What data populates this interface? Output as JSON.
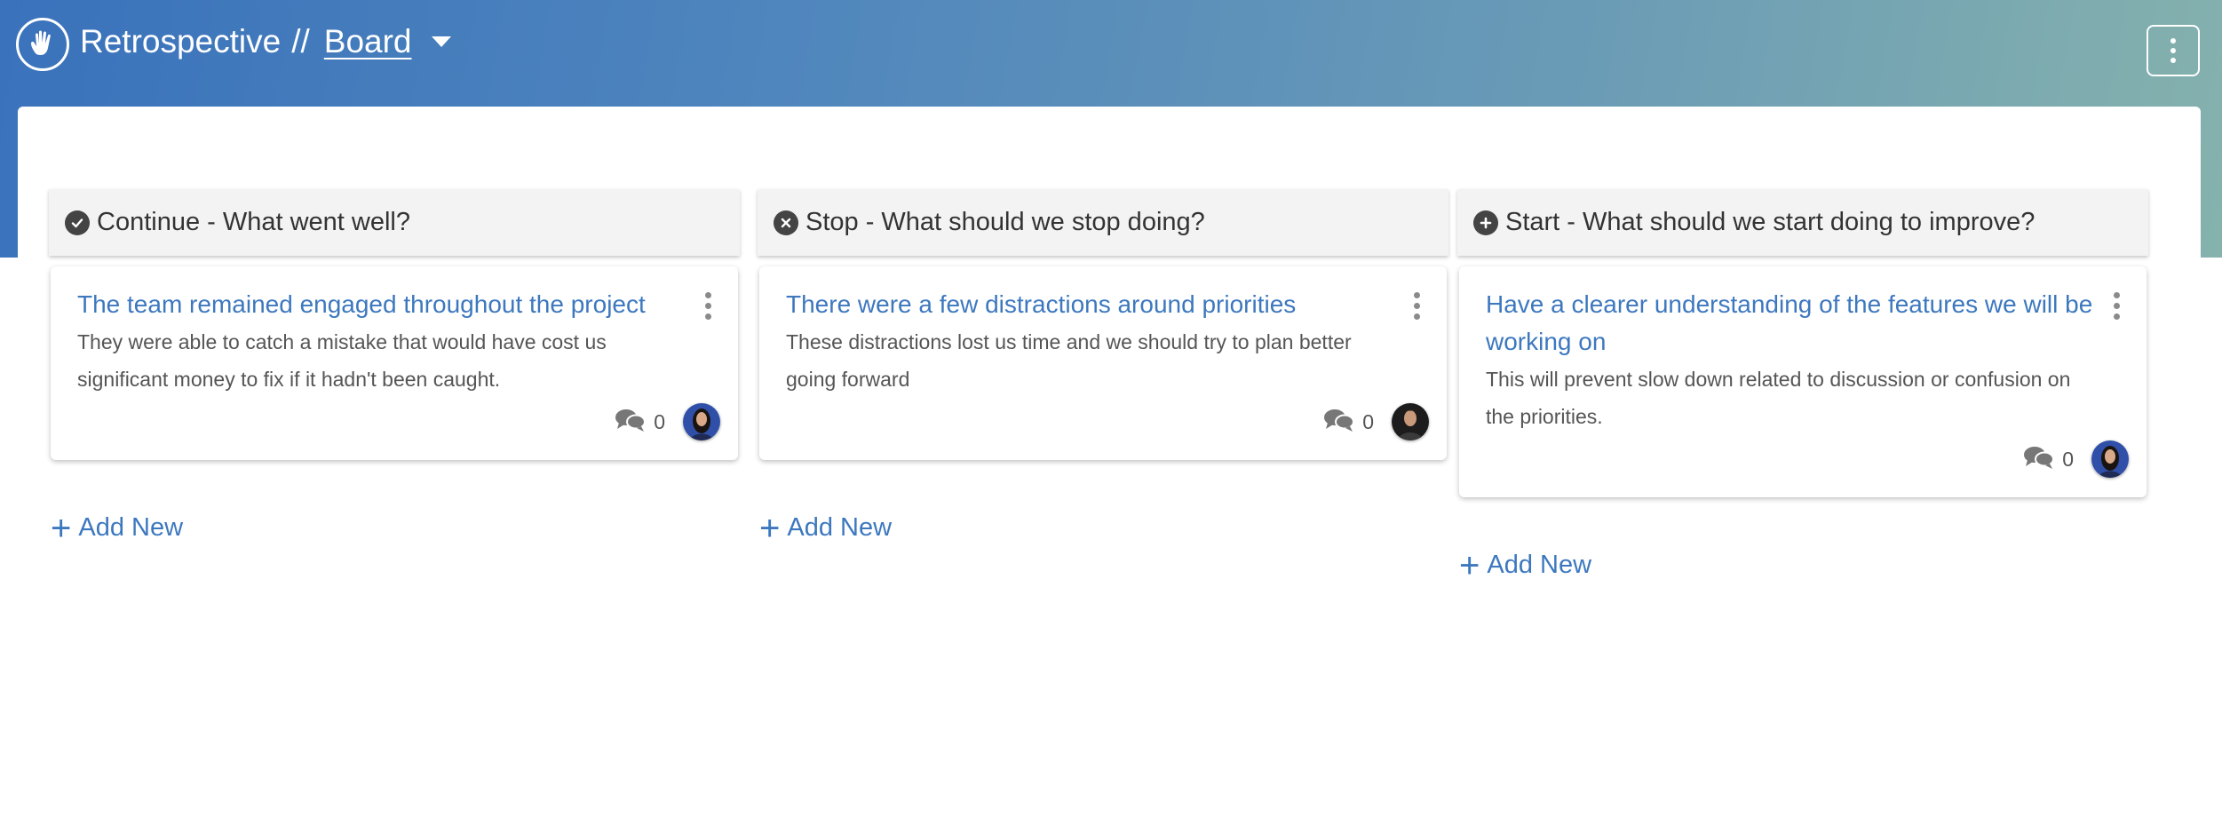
{
  "header": {
    "app_title": "Retrospective",
    "separator": "//",
    "board_link": "Board"
  },
  "columns": [
    {
      "title": "Continue - What went well?",
      "icon": "check-circle-icon",
      "add_label": "Add New",
      "cards": [
        {
          "title": "The team remained engaged throughout the project",
          "description": "They were able to catch a mistake that would have cost us significant money to fix if it hadn't been caught.",
          "comment_count": "0",
          "avatar": "woman-avatar"
        }
      ]
    },
    {
      "title": "Stop - What should we stop doing?",
      "icon": "x-circle-icon",
      "add_label": "Add New",
      "cards": [
        {
          "title": "There were a few distractions around priorities",
          "description": "These distractions lost us time and we should try to plan better going forward",
          "comment_count": "0",
          "avatar": "man-avatar"
        }
      ]
    },
    {
      "title": "Start - What should we start doing to improve?",
      "icon": "plus-circle-icon",
      "add_label": "Add New",
      "cards": [
        {
          "title": "Have a clearer understanding of the features we will be working on",
          "description": "This will prevent slow down related to discussion or confusion on the priorities.",
          "comment_count": "0",
          "avatar": "woman-avatar"
        }
      ]
    }
  ],
  "colors": {
    "gradient_start": "#3a72bc",
    "gradient_end": "#85b2ad",
    "link_blue": "#3d78bf",
    "column_header_bg": "#f3f3f4"
  }
}
